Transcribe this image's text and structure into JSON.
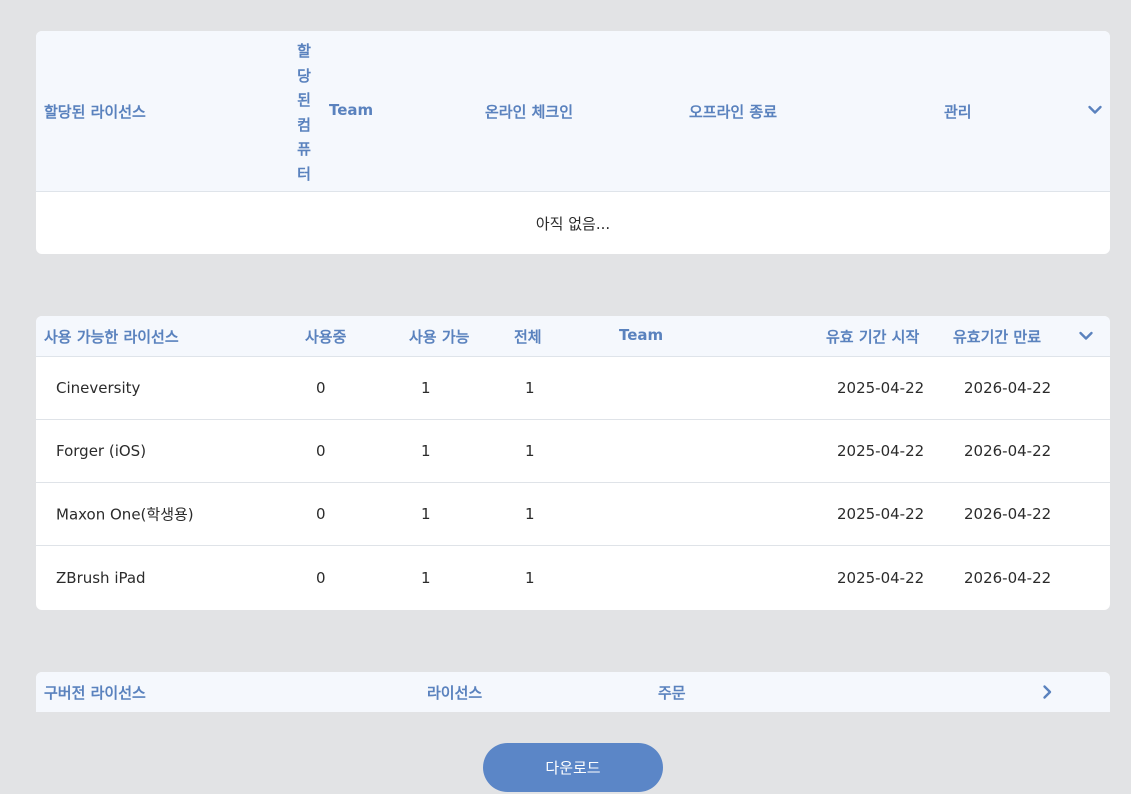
{
  "assigned": {
    "columns": {
      "license": "할당된 라이선스",
      "computer_chars": [
        "할",
        "당",
        "된",
        "컴",
        "퓨",
        "터"
      ],
      "team": "Team",
      "online_checkin": "온라인 체크인",
      "offline_end": "오프라인 종료",
      "manage": "관리"
    },
    "empty_message": "아직 없음..."
  },
  "available": {
    "columns": {
      "license": "사용 가능한 라이선스",
      "in_use": "사용중",
      "available": "사용 가능",
      "total": "전체",
      "team": "Team",
      "start": "유효 기간 시작",
      "end": "유효기간 만료"
    },
    "rows": [
      {
        "name": "Cineversity",
        "in_use": "0",
        "available": "1",
        "total": "1",
        "team": "",
        "start": "2025-04-22",
        "end": "2026-04-22"
      },
      {
        "name": "Forger (iOS)",
        "in_use": "0",
        "available": "1",
        "total": "1",
        "team": "",
        "start": "2025-04-22",
        "end": "2026-04-22"
      },
      {
        "name": "Maxon One(학생용)",
        "in_use": "0",
        "available": "1",
        "total": "1",
        "team": "",
        "start": "2025-04-22",
        "end": "2026-04-22"
      },
      {
        "name": "ZBrush iPad",
        "in_use": "0",
        "available": "1",
        "total": "1",
        "team": "",
        "start": "2025-04-22",
        "end": "2026-04-22"
      }
    ]
  },
  "legacy": {
    "columns": {
      "license": "구버전 라이선스",
      "license_col": "라이선스",
      "order": "주문"
    }
  },
  "download_label": "다운로드",
  "icons": {
    "collapse": "chevron-down-icon",
    "expand": "chevron-right-icon"
  },
  "colors": {
    "background": "#e2e3e5",
    "header_text": "#5a82be",
    "button": "#5b86c7"
  }
}
